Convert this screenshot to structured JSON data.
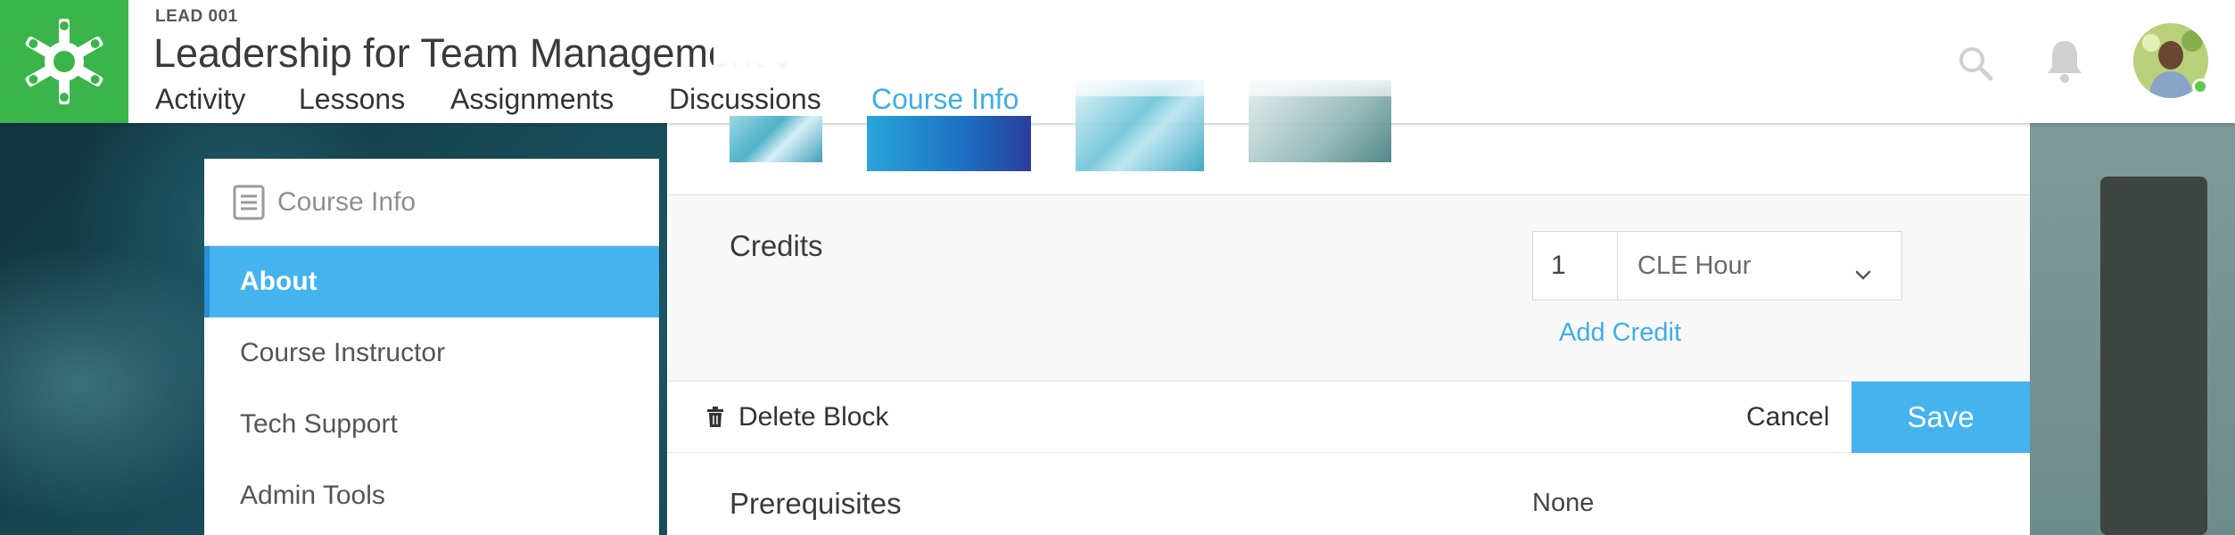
{
  "header": {
    "course_code": "LEAD 001",
    "course_title": "Leadership for Team Management",
    "tabs": [
      {
        "label": "Activity",
        "active": false
      },
      {
        "label": "Lessons",
        "active": false
      },
      {
        "label": "Assignments",
        "active": false
      },
      {
        "label": "Discussions",
        "active": false
      },
      {
        "label": "Course Info",
        "active": true
      }
    ],
    "icons": [
      "logo-icon",
      "chevron-down-icon",
      "search-icon",
      "bell-icon",
      "avatar"
    ]
  },
  "sidebar": {
    "title": "Course Info",
    "items": [
      {
        "label": "About",
        "active": true
      },
      {
        "label": "Course Instructor",
        "active": false
      },
      {
        "label": "Tech Support",
        "active": false
      },
      {
        "label": "Admin Tools",
        "active": false
      }
    ]
  },
  "credits": {
    "label": "Credits",
    "quantity": "1",
    "unit": "CLE Hour",
    "add_label": "Add Credit"
  },
  "actions": {
    "delete_label": "Delete Block",
    "cancel_label": "Cancel",
    "save_label": "Save"
  },
  "prerequisites": {
    "label": "Prerequisites",
    "value": "None"
  },
  "colors": {
    "brand_green": "#39b54a",
    "accent_blue": "#45b3ee",
    "link_blue": "#3eaee8",
    "online_green": "#5ec84e"
  }
}
